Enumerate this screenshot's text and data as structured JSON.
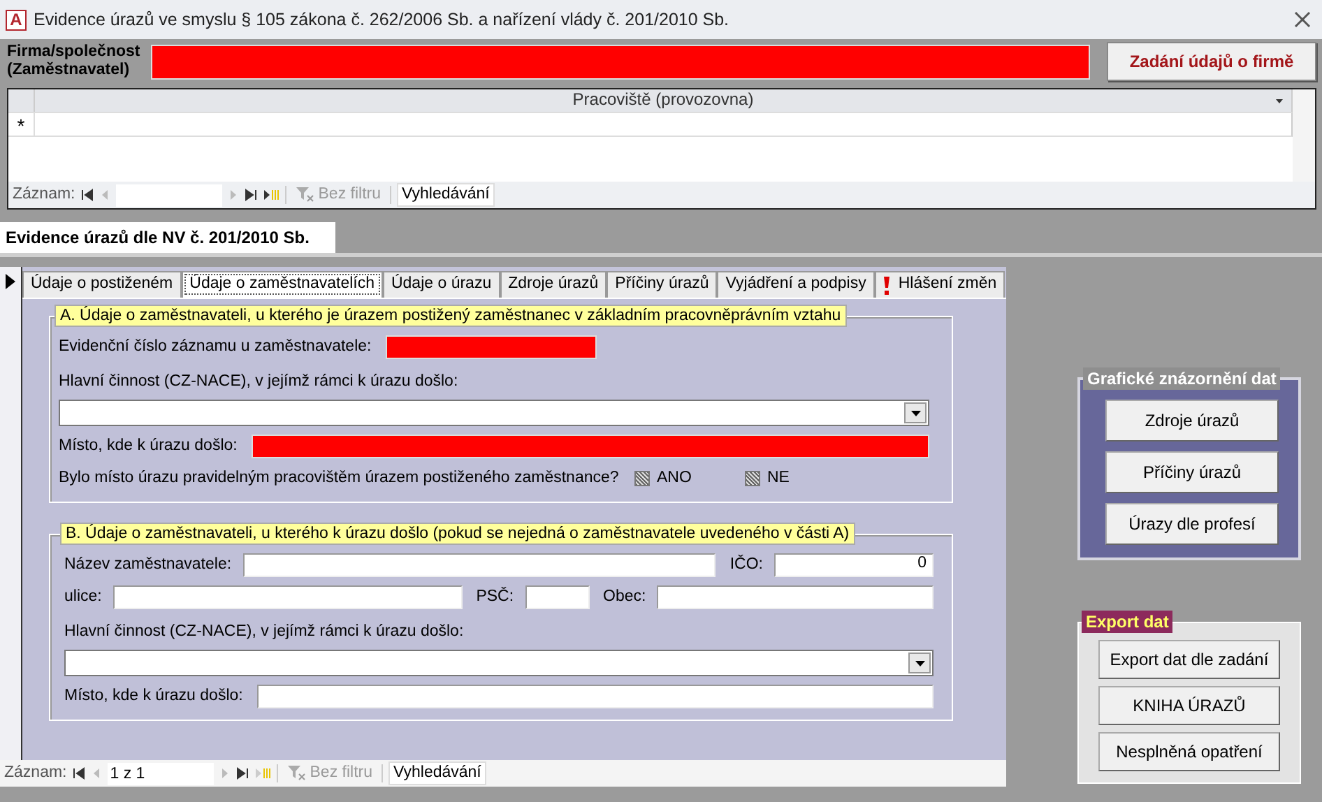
{
  "window": {
    "logo": "A",
    "title": "Evidence úrazů ve smyslu § 105 zákona č. 262/2006 Sb. a nařízení vlády č. 201/2010 Sb."
  },
  "company": {
    "label_lines": [
      "Firma/společnost",
      "(Zaměstnavatel)"
    ],
    "field_highlighted": true,
    "button": "Zadání údajů o firmě"
  },
  "workplaces": {
    "column": "Pracoviště (provozovna)",
    "new_row_marker": "*",
    "navigation": {
      "label": "Záznam:",
      "filter": "Bez filtru",
      "search": "Vyhledávání"
    }
  },
  "form_tab": "Evidence úrazů dle NV č. 201/2010 Sb.",
  "tabs": [
    {
      "label": "Údaje o postiženém",
      "selected": false,
      "kind": "plain"
    },
    {
      "label": "Údaje o zaměstnavatelích",
      "selected": true,
      "kind": "plain"
    },
    {
      "label": "Údaje o úrazu",
      "selected": false,
      "kind": "plain"
    },
    {
      "label": "Zdroje úrazů",
      "selected": false,
      "kind": "plain"
    },
    {
      "label": "Příčiny úrazů",
      "selected": false,
      "kind": "plain"
    },
    {
      "label": "Vyjádření a podpisy",
      "selected": false,
      "kind": "plain"
    },
    {
      "label": "Hlášení změn",
      "selected": false,
      "kind": "warning"
    }
  ],
  "section_a": {
    "title": "A. Údaje o zaměstnavateli, u kterého je úrazem postižený zaměstnanec v základním pracovněprávním vztahu",
    "rows": [
      {
        "kind": "short_field",
        "label": "Evidenční číslo záznamu u zaměstnavatele:",
        "highlighted": true
      },
      {
        "kind": "heading",
        "label": "Hlavní činnost (CZ-NACE), v jejímž rámci k úrazu došlo:"
      },
      {
        "kind": "combo"
      },
      {
        "kind": "wide_field",
        "label": "Místo, kde k úrazu došlo:",
        "highlighted": true
      },
      {
        "kind": "question",
        "label": "Bylo místo úrazu pravidelným pracovištěm úrazem postiženého zaměstnance?",
        "options": [
          {
            "label": "ANO",
            "indeterminate": true
          },
          {
            "label": "NE",
            "indeterminate": true
          }
        ]
      }
    ]
  },
  "section_b": {
    "title": "B. Údaje o zaměstnavateli, u kterého k úrazu došlo (pokud se nejedná o zaměstnavatele uvedeného v části A)",
    "rows": [
      {
        "kind": "fields",
        "fields": [
          {
            "label": "Název zaměstnavatele:"
          },
          {
            "label": "IČO:",
            "value": "0"
          }
        ]
      },
      {
        "kind": "fields",
        "fields": [
          {
            "label": "ulice:"
          },
          {
            "label": "PSČ:"
          },
          {
            "label": "Obec:"
          }
        ]
      },
      {
        "kind": "heading",
        "label": "Hlavní činnost (CZ-NACE), v jejímž rámci k úrazu došlo:"
      },
      {
        "kind": "combo"
      },
      {
        "kind": "wide_field",
        "label": "Místo, kde k úrazu došlo:",
        "highlighted": false
      }
    ]
  },
  "record_navigation": {
    "label": "Záznam:",
    "record": "1 z 1",
    "filter": "Bez filtru",
    "search": "Vyhledávání"
  },
  "chart_group": {
    "title": "Grafické znázornění dat",
    "buttons": [
      "Zdroje úrazů",
      "Příčiny úrazů",
      "Úrazy dle profesí"
    ]
  },
  "export_group": {
    "title": "Export dat",
    "buttons": [
      "Export dat dle zadání",
      "KNIHA ÚRAZŮ",
      "Nesplněná opatření"
    ]
  }
}
